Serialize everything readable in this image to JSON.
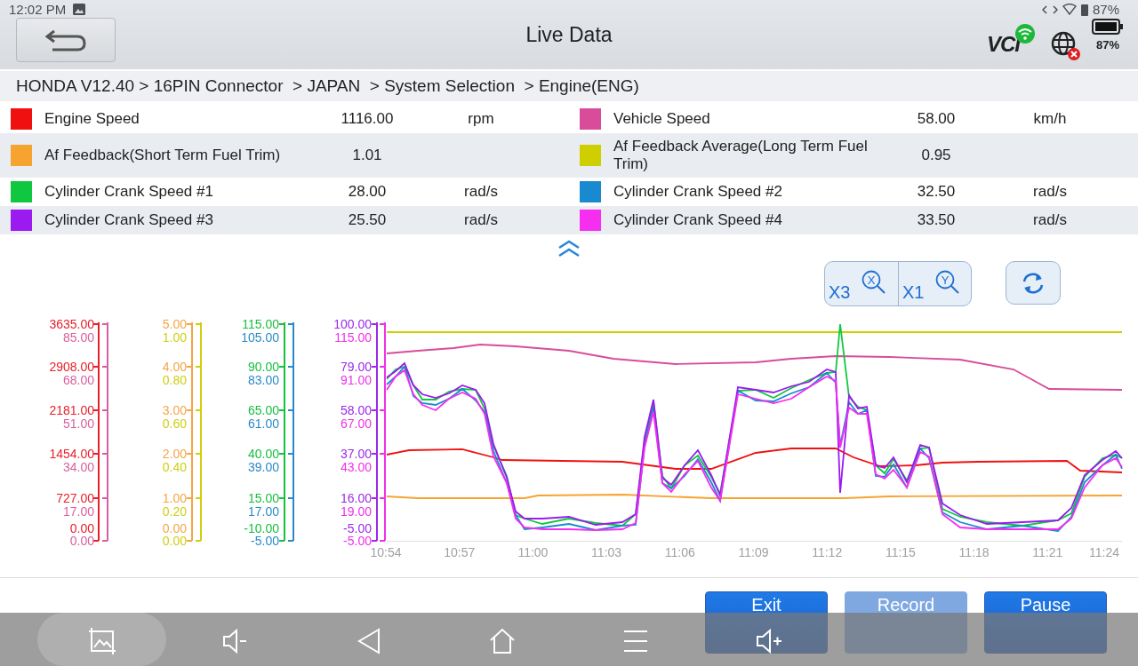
{
  "status_bar": {
    "time": "12:02 PM",
    "battery": "87%"
  },
  "header": {
    "title": "Live Data",
    "vci_label": "VCI",
    "battery": "87%"
  },
  "breadcrumb": "HONDA V12.40 > 16PIN Connector  > JAPAN  > System Selection  > Engine(ENG)",
  "readings": [
    {
      "name": "Engine Speed",
      "value": "1116.00",
      "unit": "rpm",
      "color": "#f01010"
    },
    {
      "name": "Vehicle Speed",
      "value": "58.00",
      "unit": "km/h",
      "color": "#d84c9a"
    },
    {
      "name": "Af Feedback(Short Term Fuel Trim)",
      "value": "1.01",
      "color": "#f7a330"
    },
    {
      "name": "Af Feedback Average(Long Term Fuel Trim)",
      "value": "0.95",
      "color": "#cfcf00"
    },
    {
      "name": "Cylinder Crank Speed #1",
      "value": "28.00",
      "unit": "rad/s",
      "color": "#10c840"
    },
    {
      "name": "Cylinder Crank Speed #2",
      "value": "32.50",
      "unit": "rad/s",
      "color": "#1a8ad0"
    },
    {
      "name": "Cylinder Crank Speed #3",
      "value": "25.50",
      "unit": "rad/s",
      "color": "#9a1af0"
    },
    {
      "name": "Cylinder Crank Speed #4",
      "value": "33.50",
      "unit": "rad/s",
      "color": "#f52ef0"
    }
  ],
  "zoom_controls": [
    {
      "label": "X3",
      "icon_letter": "X"
    },
    {
      "label": "X1",
      "icon_letter": "Y"
    }
  ],
  "axes": [
    [
      {
        "color": "#e8202a",
        "ticks": [
          "3635.00",
          "2908.00",
          "2181.00",
          "1454.00",
          "727.00",
          "0.00"
        ]
      },
      {
        "color": "#d9609e",
        "ticks": [
          "85.00",
          "68.00",
          "51.00",
          "34.00",
          "17.00",
          "0.00"
        ]
      }
    ],
    [
      {
        "color": "#f5a545",
        "ticks": [
          "5.00",
          "4.00",
          "3.00",
          "2.00",
          "1.00",
          "0.00"
        ]
      },
      {
        "color": "#cfcf10",
        "ticks": [
          "1.00",
          "0.80",
          "0.60",
          "0.40",
          "0.20",
          "0.00"
        ]
      }
    ],
    [
      {
        "color": "#18c040",
        "ticks": [
          "115.00",
          "90.00",
          "65.00",
          "40.00",
          "15.00",
          "-10.00"
        ]
      },
      {
        "color": "#2a8ac8",
        "ticks": [
          "105.00",
          "83.00",
          "61.00",
          "39.00",
          "17.00",
          "-5.00"
        ]
      }
    ],
    [
      {
        "color": "#9a2ae8",
        "ticks": [
          "100.00",
          "79.00",
          "58.00",
          "37.00",
          "16.00",
          "-5.00"
        ]
      },
      {
        "color": "#f030e8",
        "ticks": [
          "115.00",
          "91.00",
          "67.00",
          "43.00",
          "19.00",
          "-5.00"
        ]
      }
    ]
  ],
  "x_ticks": [
    "10:54",
    "10:57",
    "11:00",
    "11:03",
    "11:06",
    "11:09",
    "11:12",
    "11:15",
    "11:18",
    "11:21",
    "11:24"
  ],
  "buttons": [
    {
      "label": "Exit",
      "disabled": false
    },
    {
      "label": "Record",
      "disabled": true
    },
    {
      "label": "Pause",
      "disabled": false
    }
  ]
}
